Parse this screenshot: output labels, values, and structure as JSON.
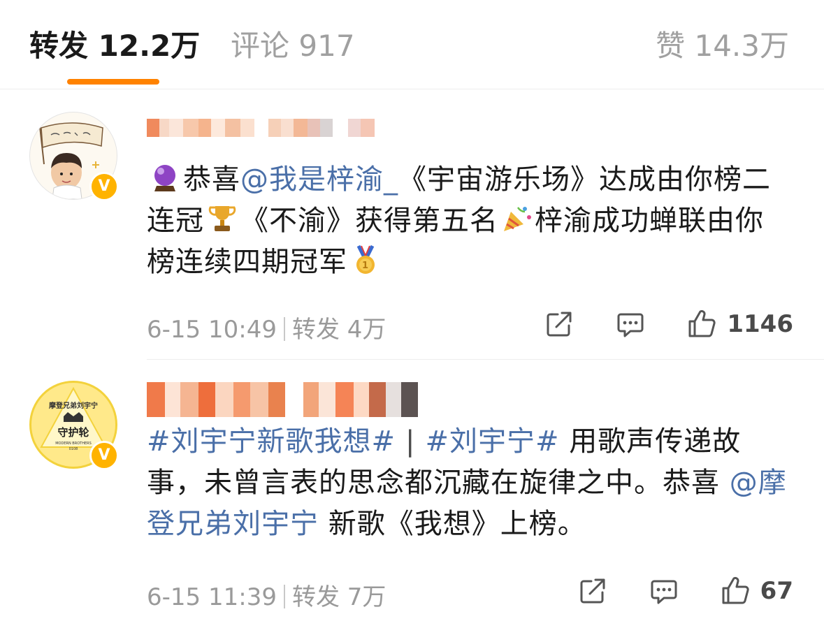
{
  "tabs": {
    "repost_label": "转发",
    "repost_count": "12.2万",
    "comment_label": "评论",
    "comment_count": "917",
    "like_label": "赞",
    "like_count": "14.3万",
    "active": "repost"
  },
  "colors": {
    "accent": "#ff8200",
    "link": "#4a6fa8",
    "muted": "#9a9a9a",
    "verified_badge": "#ffb300"
  },
  "posts": [
    {
      "content": {
        "t1": "恭喜",
        "mention": "@我是梓渝_",
        "t2": "《宇宙游乐场》达成由你榜二连冠",
        "t3": "《不渝》获得第五名",
        "t4": "梓渝成功蝉联由你榜连续四期冠军"
      },
      "emoji": [
        "crystal-ball",
        "trophy",
        "party-popper",
        "gold-medal"
      ],
      "time": "6-15 10:49",
      "repost_label": "转发",
      "repost_count": "4万",
      "likes": "1146",
      "verified": true
    },
    {
      "content": {
        "hashtag1": "#刘宇宁新歌我想#",
        "sep": "|",
        "hashtag2": "#刘宇宁#",
        "t1": "用歌声传递故事，未曾言表的思念都沉藏在旋律之中。恭喜",
        "mention": "@摩登兄弟刘宇宁",
        "t2": "新歌《我想》上榜。"
      },
      "avatar_text": {
        "top": "摩登兄弟刘宇宁",
        "middle": "守护轮",
        "bottom": "MODERN BROTHERS",
        "num": "0108"
      },
      "time": "6-15 11:39",
      "repost_label": "转发",
      "repost_count": "7万",
      "likes": "67",
      "verified": true
    }
  ],
  "icons": {
    "share": "share-icon",
    "comment": "comment-icon",
    "like": "thumbs-up-icon",
    "verified": "verified-v-icon"
  }
}
